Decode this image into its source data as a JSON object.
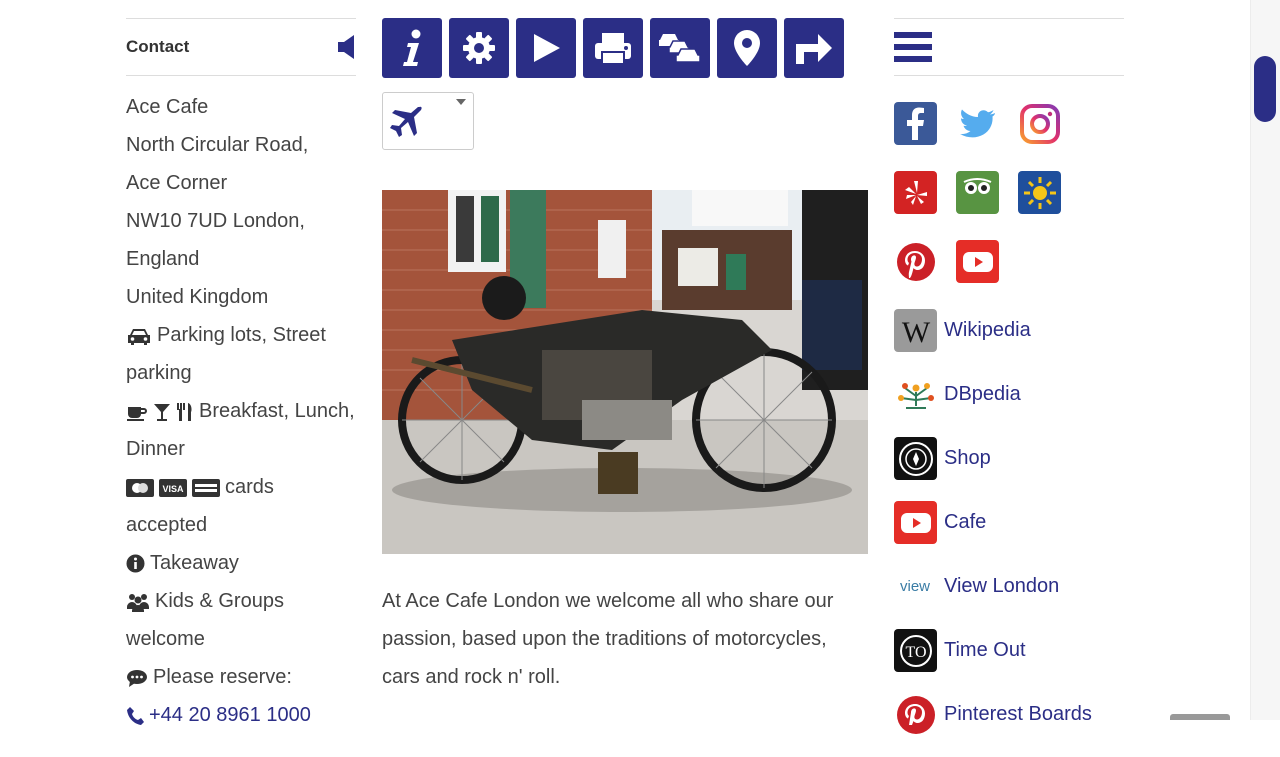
{
  "contact": {
    "title": "Contact",
    "lines": [
      "Ace Cafe",
      "North Circular Road,",
      "Ace Corner",
      "NW10 7UD London,",
      "England",
      "United Kingdom"
    ],
    "parking": "Parking lots, Street parking",
    "meals": "Breakfast, Lunch, Dinner",
    "cards": "cards accepted",
    "takeaway": "Takeaway",
    "kids": "Kids & Groups welcome",
    "reserve": "Please reserve:",
    "phone": "+44 20 8961 1000"
  },
  "toolbar": {
    "icons": [
      "info-icon",
      "gear-icon",
      "play-icon",
      "print-icon",
      "cars-icon",
      "location-pin-icon",
      "directions-icon"
    ],
    "transport_select_icon": "airplane-icon",
    "color": "#2b2e86"
  },
  "description": "At Ace Cafe London we welcome all who share our passion, based upon the traditions of motorcycles, cars and rock n' roll.",
  "social": [
    "facebook",
    "twitter",
    "instagram",
    "yelp",
    "tripadvisor",
    "yandex",
    "pinterest",
    "youtube"
  ],
  "tripadvisor_text": "tripadvisor",
  "links": [
    {
      "label": "Wikipedia"
    },
    {
      "label": "DBpedia"
    },
    {
      "label": "Shop"
    },
    {
      "label": "Cafe"
    },
    {
      "label": "View London"
    },
    {
      "label": "Time Out"
    },
    {
      "label": "Pinterest Boards"
    }
  ],
  "view_logo_text": "view",
  "timeout_logo_text": "TO"
}
